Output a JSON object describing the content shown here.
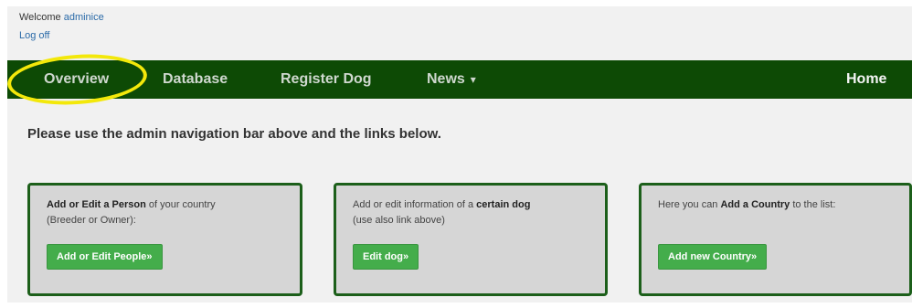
{
  "header": {
    "welcome_prefix": "Welcome",
    "username": "adminice",
    "logoff": "Log off"
  },
  "nav": {
    "items": [
      "Overview",
      "Database",
      "Register Dog",
      "News"
    ],
    "news_caret": "▾",
    "home": "Home"
  },
  "main": {
    "intro": "Please use the admin navigation bar above and the links below."
  },
  "cards": [
    {
      "pre": "Add or Edit a Person",
      "post": " of your country",
      "line2": "(Breeder or Owner):",
      "button": "Add or Edit People»"
    },
    {
      "pre": "Add or edit information of a ",
      "bold": "certain dog",
      "line2": "(use also link above)",
      "button": "Edit dog»"
    },
    {
      "pre": "Here you can ",
      "bold": "Add a Country",
      "post": " to the list:",
      "button": "Add new Country»"
    }
  ],
  "colors": {
    "navbar": "#0d4a05",
    "button": "#44ad4b",
    "card_border": "#1c5f1a",
    "highlight": "#f3e80a",
    "link": "#2a6aa8"
  }
}
